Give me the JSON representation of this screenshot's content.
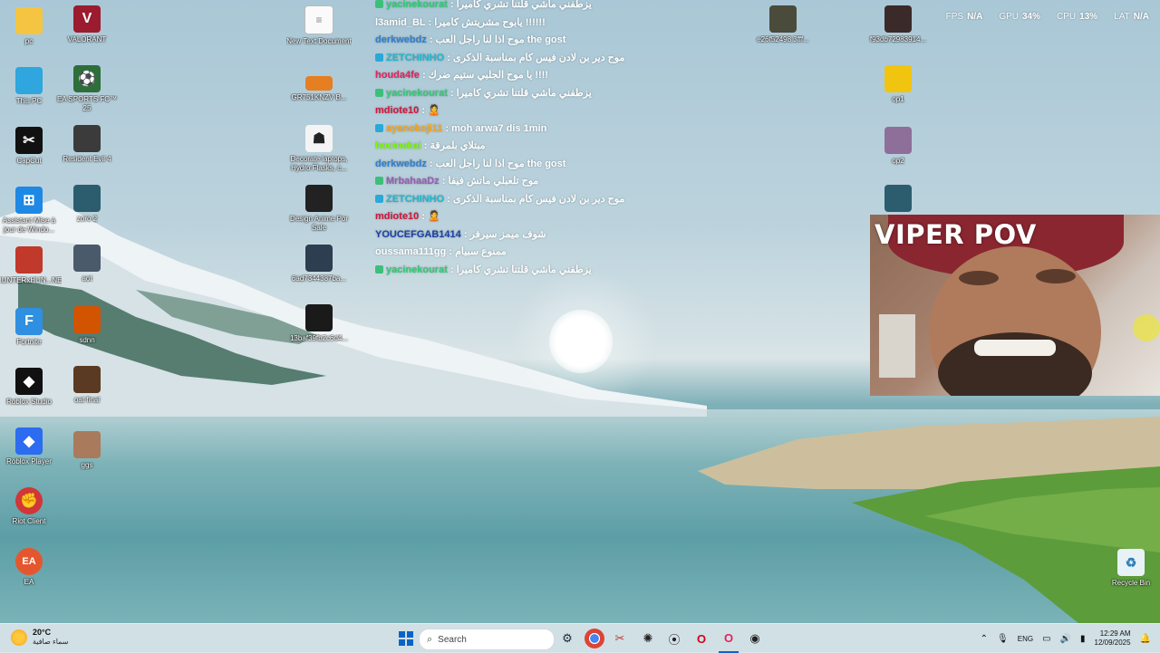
{
  "performance": {
    "fps_label": "FPS",
    "fps_value": "N/A",
    "gpu_label": "GPU",
    "gpu_value": "34%",
    "cpu_label": "CPU",
    "cpu_value": "13%",
    "lat_label": "LAT",
    "lat_value": "N/A"
  },
  "desktop_icons": {
    "pc": "pc",
    "valorant": "VALORANT",
    "this_pc": "This PC",
    "ea_fc": "EA SPORTS FC™ 25",
    "capcut": "CapCut",
    "re4": "Resident Evil 4",
    "assistant": "Assistant Mise à jour de Windo...",
    "zoro": "zoro 2",
    "hunter": "HUNTERxHUN...NENxIMPACT",
    "aot": "aot",
    "fortnite": "Fortnite",
    "sdnn": "sdnn",
    "roblox_studio": "Roblox Studio",
    "oat_final": "oat final",
    "roblox_player": "Roblox Player",
    "ggs": "ggs",
    "riot": "Riot Client",
    "ea": "EA",
    "new_text": "New Text Document",
    "gr": "GR751KNZV B...",
    "decorate": "Decorate laptops, Hydro Flasks, c...",
    "design_anime": "Design Anime Por Sale",
    "sad": "6ad7344387ba...",
    "baf": "13baf39fb2c6d4...",
    "e26": "e26f52498.3fff...",
    "f9": "f93db72983914...",
    "op1": "op1",
    "op2": "op2",
    "recycle": "Recycle Bin"
  },
  "chat": [
    {
      "user": "yacinekourat",
      "color": "#2ecc71",
      "badge": "g",
      "text": "يزطفني ماشي قلتنا تشري كاميرا"
    },
    {
      "user": "l3amid_BL",
      "color": "#ffffff",
      "badge": "",
      "text": "يابوح مشريتش كاميرا !!!!!!"
    },
    {
      "user": "derkwebdz",
      "color": "#2e7fd0",
      "badge": "",
      "text": "موح اذا لنا راجل العب the gost"
    },
    {
      "user": "ZETCHINHO",
      "color": "#1fb8d0",
      "badge": "b",
      "text": "موح دير بن لادن فيس كام بمناسبة الذكرى"
    },
    {
      "user": "houda4fe",
      "color": "#e0245e",
      "badge": "",
      "text": "يا موح الجلبي ستيم ضرك !!!!"
    },
    {
      "user": "yacinekourat",
      "color": "#2ecc71",
      "badge": "g",
      "text": "يزطفني ماشي قلتنا تشري كاميرا"
    },
    {
      "user": "mdiote10",
      "color": "#d4143c",
      "badge": "",
      "text": "🙎"
    },
    {
      "user": "ayanokoji11",
      "color": "#f5a623",
      "badge": "b",
      "text": "moh arwa7 dis 1min"
    },
    {
      "user": "hocinekai",
      "color": "#7cfc00",
      "badge": "",
      "text": "مبتلاي بلمرقة"
    },
    {
      "user": "derkwebdz",
      "color": "#2e7fd0",
      "badge": "",
      "text": "موح اذا لنا راجل العب the gost"
    },
    {
      "user": "MrbahaaDz",
      "color": "#9b59b6",
      "badge": "g",
      "text": "موح تلعبلي ماتش فيفا"
    },
    {
      "user": "ZETCHINHO",
      "color": "#1fb8d0",
      "badge": "b",
      "text": "موح دير بن لادن فيس كام بمناسبة الذكرى"
    },
    {
      "user": "mdiote10",
      "color": "#d4143c",
      "badge": "",
      "text": "🙎"
    },
    {
      "user": "YOUCEFGAB1414",
      "color": "#1e3fa8",
      "badge": "",
      "text": "شوف ميمز سيرفر"
    },
    {
      "user": "oussama111gg",
      "color": "#ffffff",
      "badge": "",
      "text": "ممنوع سبيام"
    },
    {
      "user": "yacinekourat",
      "color": "#2ecc71",
      "badge": "g",
      "text": "يزطفني ماشي قلتنا تشري كاميرا"
    }
  ],
  "webcam": {
    "title": "VIPER POV"
  },
  "taskbar": {
    "weather_temp": "20°C",
    "weather_desc": "سماء صافية",
    "search_placeholder": "Search",
    "language": "ENG",
    "time": "12:29 AM",
    "date": "12/09/2025",
    "accent": "#0a64c8"
  }
}
